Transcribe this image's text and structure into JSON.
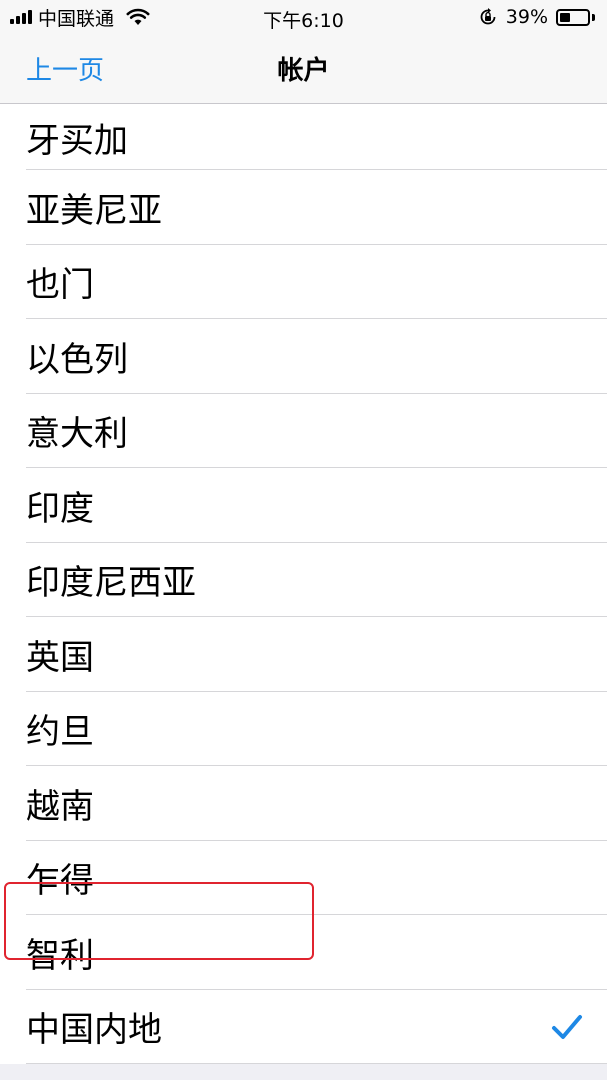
{
  "status_bar": {
    "carrier": "中国联通",
    "time": "下午6:10",
    "battery_percent": "39%",
    "battery_level": 0.39
  },
  "nav": {
    "back_label": "上一页",
    "title": "帐户"
  },
  "accent_color": "#1e88e5",
  "highlight_color": "#e0242f",
  "countries": [
    {
      "label": "牙买加",
      "selected": false
    },
    {
      "label": "亚美尼亚",
      "selected": false
    },
    {
      "label": "也门",
      "selected": false
    },
    {
      "label": "以色列",
      "selected": false
    },
    {
      "label": "意大利",
      "selected": false
    },
    {
      "label": "印度",
      "selected": false
    },
    {
      "label": "印度尼西亚",
      "selected": false
    },
    {
      "label": "英国",
      "selected": false
    },
    {
      "label": "约旦",
      "selected": false
    },
    {
      "label": "越南",
      "selected": false
    },
    {
      "label": "乍得",
      "selected": false
    },
    {
      "label": "智利",
      "selected": false
    },
    {
      "label": "中国内地",
      "selected": true
    }
  ]
}
